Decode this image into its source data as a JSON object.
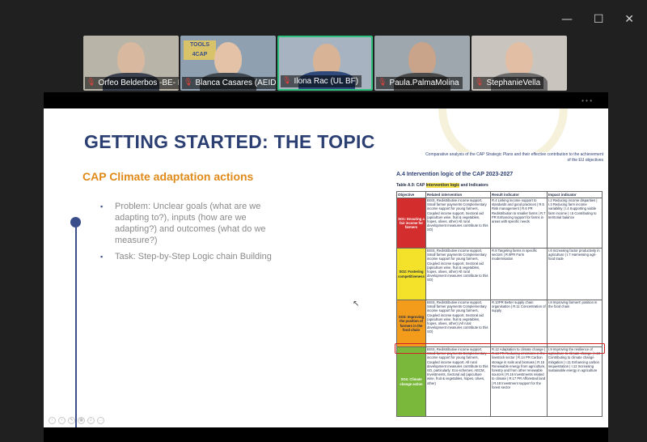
{
  "window_controls": {
    "minimize": "—",
    "maximize": "☐",
    "close": "✕"
  },
  "participants": [
    {
      "name": "Orfeo Belderbos -BE- F...",
      "bg": "#b9b4a8",
      "skin": "#d8b9a0",
      "shirt": "#3c4150"
    },
    {
      "name": "Blanca Casares (AEIDL)",
      "bg": "#8fa0b0",
      "skin": "#e4c2a8",
      "shirt": "#41474f",
      "logo": "TOOLS 4CAP"
    },
    {
      "name": "Ilona Rac (UL BF)",
      "bg": "#a7b3c0",
      "skin": "#d9b395",
      "shirt": "#2f4a7a",
      "active": true
    },
    {
      "name": "Paula.PalmaMolina",
      "bg": "#9da7ad",
      "skin": "#c9a38a",
      "shirt": "#4a4a4a"
    },
    {
      "name": "StephanieVella",
      "bg": "#c9c4bd",
      "skin": "#e2bfa4",
      "shirt": "#6b6b6b"
    }
  ],
  "slide": {
    "title": "GETTING STARTED: THE TOPIC",
    "subtitle": "CAP Climate adaptation actions",
    "bullets": [
      "Problem: Unclear goals  (what are we adapting to?), inputs (how are we adapting?) and outcomes (what do we measure?)",
      "Task: Step-by-Step Logic chain Building"
    ]
  },
  "doc": {
    "header": "Comparative analysis of the CAP Strategic Plans and their effective contribution to the achievement of the EU objectives",
    "section": "A.4    Intervention logic of the CAP 2023-2027",
    "table_label_pre": "Table A.9:  CAP ",
    "table_label_hl": "Intervention logic",
    "table_label_post": " and Indicators",
    "columns": [
      "Objective",
      "Related intervention",
      "Result indicator",
      "Impact indicator"
    ],
    "rows": [
      {
        "objective": "SO1: Ensuring a fair income for farmers",
        "intervention": "BISS, Redistributive income support, Small farmer payments Complementary income support for young farmers, Coupled income support, Sectoral aid (apiculture wine, fruit & vegetables, hopes, olives, other) All rural development measures contribute to this SO)",
        "result": "R.4 Linking income support to standards and good practices | R.5 Risk management | R.6 PR Redistribution to smaller farms | R.7 PR Enhancing support for farms in areas with specific needs",
        "impact": "I.2 Reducing income disparities | I.3 Reducing farm income variability | I.4 Supporting viable farm income | I.5 Contributing to territorial balance"
      },
      {
        "objective": "SO2: Fostering competitiveness",
        "intervention": "BISS, Redistributive income support, Small farmer payments Complementary income support for young farmers, Coupled income support, Sectoral aid (apiculture wine, fruit & vegetables, hopes, olives, other) All rural development measures contribute to this SO)",
        "result": "R.8 Targeting farms in specific sectors | R.9PR Farm modernisation",
        "impact": "I.6 Increasing factor productivity in agriculture | I.7 Harnessing agri-food trade"
      },
      {
        "objective": "SO3: Improving the position of farmers in the food chain",
        "intervention": "BISS, Redistributive income support, Small farmer payments Complementary income support for young farmers, Coupled income support, Sectoral aid (apiculture wine, fruit & vegetables, hopes, olives, other) (All rural development measures contribute to this SO)",
        "result": "R.10PR Better supply chain organisation | R.11 Concentration of supply",
        "impact": "I.8 Improving farmers' position in the food chain"
      },
      {
        "objective": "SO4: Climate change action",
        "intervention": "BISS, Redistributive income support, Small farmer payments Complementary income support for young farmers, Coupled income support, All rural development measures contribute to this SO, particularly: Eco-schemes, AECM, Investments, Sectoral aid (apiculture wine, fruit & vegetables, hopes, olives, other)",
        "result": "R.12 Adaptation to climate change | R.13 PR Reducing emissions in the livestock sector | R.14 PR Carbon storage in soils and biomass | R.15 Renewable energy from agriculture, forestry and from other renewable sources | R.16 Investments related to climate | R.17 PR Afforested land | R.18 Investment support for the forest sector",
        "impact": "I.9 Improving the resilience of agriculture to climate change | I.10 Contributing to climate change mitigation | I.11 Enhancing carbon sequestration | I.12 Increasing sustainable energy in agriculture"
      }
    ]
  }
}
